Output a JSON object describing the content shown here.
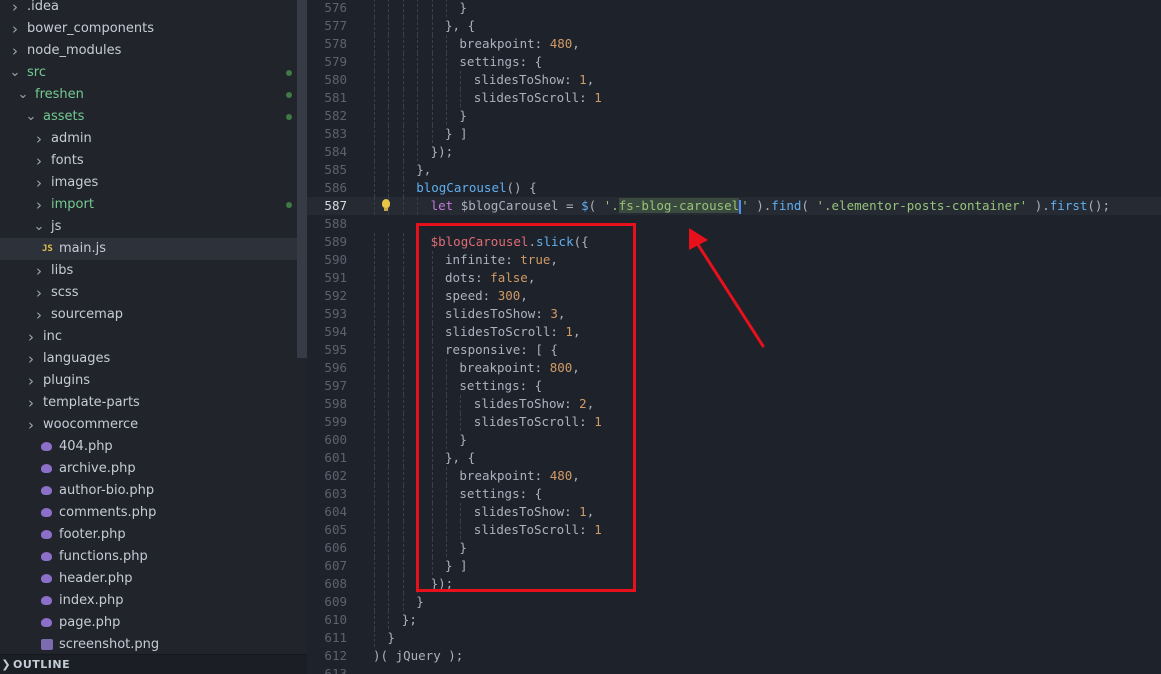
{
  "sidebar": {
    "items": [
      {
        "label": ".idea",
        "kind": "folder",
        "expanded": false,
        "depth": 0,
        "git": false
      },
      {
        "label": "bower_components",
        "kind": "folder",
        "expanded": false,
        "depth": 0,
        "git": false
      },
      {
        "label": "node_modules",
        "kind": "folder",
        "expanded": false,
        "depth": 0,
        "git": false
      },
      {
        "label": "src",
        "kind": "folder",
        "expanded": true,
        "depth": 0,
        "git": true
      },
      {
        "label": "freshen",
        "kind": "folder",
        "expanded": true,
        "depth": 1,
        "git": true
      },
      {
        "label": "assets",
        "kind": "folder",
        "expanded": true,
        "depth": 2,
        "git": true
      },
      {
        "label": "admin",
        "kind": "folder",
        "expanded": false,
        "depth": 3,
        "git": false
      },
      {
        "label": "fonts",
        "kind": "folder",
        "expanded": false,
        "depth": 3,
        "git": false
      },
      {
        "label": "images",
        "kind": "folder",
        "expanded": false,
        "depth": 3,
        "git": false
      },
      {
        "label": "import",
        "kind": "folder",
        "expanded": false,
        "depth": 3,
        "git": true
      },
      {
        "label": "js",
        "kind": "folder",
        "expanded": true,
        "depth": 3,
        "git": false
      },
      {
        "label": "main.js",
        "kind": "js",
        "depth": 4,
        "git": false,
        "selected": true
      },
      {
        "label": "libs",
        "kind": "folder",
        "expanded": false,
        "depth": 3,
        "git": false
      },
      {
        "label": "scss",
        "kind": "folder",
        "expanded": false,
        "depth": 3,
        "git": false
      },
      {
        "label": "sourcemap",
        "kind": "folder",
        "expanded": false,
        "depth": 3,
        "git": false
      },
      {
        "label": "inc",
        "kind": "folder",
        "expanded": false,
        "depth": 2,
        "git": false
      },
      {
        "label": "languages",
        "kind": "folder",
        "expanded": false,
        "depth": 2,
        "git": false
      },
      {
        "label": "plugins",
        "kind": "folder",
        "expanded": false,
        "depth": 2,
        "git": false
      },
      {
        "label": "template-parts",
        "kind": "folder",
        "expanded": false,
        "depth": 2,
        "git": false
      },
      {
        "label": "woocommerce",
        "kind": "folder",
        "expanded": false,
        "depth": 2,
        "git": false
      },
      {
        "label": "404.php",
        "kind": "php",
        "depth": 2,
        "git": false
      },
      {
        "label": "archive.php",
        "kind": "php",
        "depth": 2,
        "git": false
      },
      {
        "label": "author-bio.php",
        "kind": "php",
        "depth": 2,
        "git": false
      },
      {
        "label": "comments.php",
        "kind": "php",
        "depth": 2,
        "git": false
      },
      {
        "label": "footer.php",
        "kind": "php",
        "depth": 2,
        "git": false
      },
      {
        "label": "functions.php",
        "kind": "php",
        "depth": 2,
        "git": false
      },
      {
        "label": "header.php",
        "kind": "php",
        "depth": 2,
        "git": false
      },
      {
        "label": "index.php",
        "kind": "php",
        "depth": 2,
        "git": false
      },
      {
        "label": "page.php",
        "kind": "php",
        "depth": 2,
        "git": false
      },
      {
        "label": "screenshot.png",
        "kind": "image",
        "depth": 2,
        "git": false
      }
    ],
    "js_badge": "JS",
    "outline_label": "OUTLINE"
  },
  "editor": {
    "active_line": "587",
    "lines": [
      {
        "n": "576",
        "i": 6,
        "t": [
          [
            "}",
            "plain"
          ]
        ]
      },
      {
        "n": "577",
        "i": 5,
        "t": [
          [
            "}, {",
            "plain"
          ]
        ]
      },
      {
        "n": "578",
        "i": 6,
        "t": [
          [
            "breakpoint",
            "prop"
          ],
          [
            ": ",
            "plain"
          ],
          [
            "480",
            "num"
          ],
          [
            ",",
            "plain"
          ]
        ]
      },
      {
        "n": "579",
        "i": 6,
        "t": [
          [
            "settings",
            "prop"
          ],
          [
            ": {",
            "plain"
          ]
        ]
      },
      {
        "n": "580",
        "i": 7,
        "t": [
          [
            "slidesToShow",
            "prop"
          ],
          [
            ": ",
            "plain"
          ],
          [
            "1",
            "num"
          ],
          [
            ",",
            "plain"
          ]
        ]
      },
      {
        "n": "581",
        "i": 7,
        "t": [
          [
            "slidesToScroll",
            "prop"
          ],
          [
            ": ",
            "plain"
          ],
          [
            "1",
            "num"
          ]
        ]
      },
      {
        "n": "582",
        "i": 6,
        "t": [
          [
            "}",
            "plain"
          ]
        ]
      },
      {
        "n": "583",
        "i": 5,
        "t": [
          [
            "} ]",
            "plain"
          ]
        ]
      },
      {
        "n": "584",
        "i": 4,
        "t": [
          [
            "});",
            "plain"
          ]
        ]
      },
      {
        "n": "585",
        "i": 3,
        "t": [
          [
            "},",
            "plain"
          ]
        ]
      },
      {
        "n": "586",
        "i": 3,
        "t": [
          [
            "blogCarousel",
            "fn"
          ],
          [
            "() {",
            "plain"
          ]
        ]
      },
      {
        "n": "587",
        "i": 4,
        "t": [
          [
            "let",
            "kw"
          ],
          [
            " $blogCarousel = ",
            "plain"
          ],
          [
            "$",
            "fn"
          ],
          [
            "( ",
            "plain"
          ],
          [
            "'.",
            "str"
          ],
          [
            "fs-blog-carousel",
            "sel"
          ],
          [
            "CURSOR",
            "cursor"
          ],
          [
            "'",
            "str"
          ],
          [
            " ).",
            "plain"
          ],
          [
            "find",
            "fn"
          ],
          [
            "( ",
            "plain"
          ],
          [
            "'.elementor-posts-container'",
            "str"
          ],
          [
            " ).",
            "plain"
          ],
          [
            "first",
            "fn"
          ],
          [
            "();",
            "plain"
          ]
        ]
      },
      {
        "n": "588",
        "i": 0,
        "t": []
      },
      {
        "n": "589",
        "i": 4,
        "t": [
          [
            "$blogCarousel",
            "var"
          ],
          [
            ".",
            "plain"
          ],
          [
            "slick",
            "fn"
          ],
          [
            "({",
            "plain"
          ]
        ]
      },
      {
        "n": "590",
        "i": 5,
        "t": [
          [
            "infinite",
            "prop"
          ],
          [
            ": ",
            "plain"
          ],
          [
            "true",
            "bool"
          ],
          [
            ",",
            "plain"
          ]
        ]
      },
      {
        "n": "591",
        "i": 5,
        "t": [
          [
            "dots",
            "prop"
          ],
          [
            ": ",
            "plain"
          ],
          [
            "false",
            "bool"
          ],
          [
            ",",
            "plain"
          ]
        ]
      },
      {
        "n": "592",
        "i": 5,
        "t": [
          [
            "speed",
            "prop"
          ],
          [
            ": ",
            "plain"
          ],
          [
            "300",
            "num"
          ],
          [
            ",",
            "plain"
          ]
        ]
      },
      {
        "n": "593",
        "i": 5,
        "t": [
          [
            "slidesToShow",
            "prop"
          ],
          [
            ": ",
            "plain"
          ],
          [
            "3",
            "num"
          ],
          [
            ",",
            "plain"
          ]
        ]
      },
      {
        "n": "594",
        "i": 5,
        "t": [
          [
            "slidesToScroll",
            "prop"
          ],
          [
            ": ",
            "plain"
          ],
          [
            "1",
            "num"
          ],
          [
            ",",
            "plain"
          ]
        ]
      },
      {
        "n": "595",
        "i": 5,
        "t": [
          [
            "responsive",
            "prop"
          ],
          [
            ": [ {",
            "plain"
          ]
        ]
      },
      {
        "n": "596",
        "i": 6,
        "t": [
          [
            "breakpoint",
            "prop"
          ],
          [
            ": ",
            "plain"
          ],
          [
            "800",
            "num"
          ],
          [
            ",",
            "plain"
          ]
        ]
      },
      {
        "n": "597",
        "i": 6,
        "t": [
          [
            "settings",
            "prop"
          ],
          [
            ": {",
            "plain"
          ]
        ]
      },
      {
        "n": "598",
        "i": 7,
        "t": [
          [
            "slidesToShow",
            "prop"
          ],
          [
            ": ",
            "plain"
          ],
          [
            "2",
            "num"
          ],
          [
            ",",
            "plain"
          ]
        ]
      },
      {
        "n": "599",
        "i": 7,
        "t": [
          [
            "slidesToScroll",
            "prop"
          ],
          [
            ": ",
            "plain"
          ],
          [
            "1",
            "num"
          ]
        ]
      },
      {
        "n": "600",
        "i": 6,
        "t": [
          [
            "}",
            "plain"
          ]
        ]
      },
      {
        "n": "601",
        "i": 5,
        "t": [
          [
            "}, {",
            "plain"
          ]
        ]
      },
      {
        "n": "602",
        "i": 6,
        "t": [
          [
            "breakpoint",
            "prop"
          ],
          [
            ": ",
            "plain"
          ],
          [
            "480",
            "num"
          ],
          [
            ",",
            "plain"
          ]
        ]
      },
      {
        "n": "603",
        "i": 6,
        "t": [
          [
            "settings",
            "prop"
          ],
          [
            ": {",
            "plain"
          ]
        ]
      },
      {
        "n": "604",
        "i": 7,
        "t": [
          [
            "slidesToShow",
            "prop"
          ],
          [
            ": ",
            "plain"
          ],
          [
            "1",
            "num"
          ],
          [
            ",",
            "plain"
          ]
        ]
      },
      {
        "n": "605",
        "i": 7,
        "t": [
          [
            "slidesToScroll",
            "prop"
          ],
          [
            ": ",
            "plain"
          ],
          [
            "1",
            "num"
          ]
        ]
      },
      {
        "n": "606",
        "i": 6,
        "t": [
          [
            "}",
            "plain"
          ]
        ]
      },
      {
        "n": "607",
        "i": 5,
        "t": [
          [
            "} ]",
            "plain"
          ]
        ]
      },
      {
        "n": "608",
        "i": 4,
        "t": [
          [
            "});",
            "plain"
          ]
        ]
      },
      {
        "n": "609",
        "i": 3,
        "t": [
          [
            "}",
            "plain"
          ]
        ]
      },
      {
        "n": "610",
        "i": 2,
        "t": [
          [
            "};",
            "plain"
          ]
        ]
      },
      {
        "n": "611",
        "i": 1,
        "t": [
          [
            "}",
            "plain"
          ]
        ]
      },
      {
        "n": "612",
        "i": 0,
        "t": [
          [
            ")( ",
            "plain"
          ],
          [
            "jQuery",
            "plain"
          ],
          [
            " );",
            "plain"
          ]
        ]
      },
      {
        "n": "613",
        "i": 0,
        "t": []
      }
    ]
  },
  "colors": {
    "annotation_red": "#e8101b",
    "git_added_green": "#73c991"
  }
}
